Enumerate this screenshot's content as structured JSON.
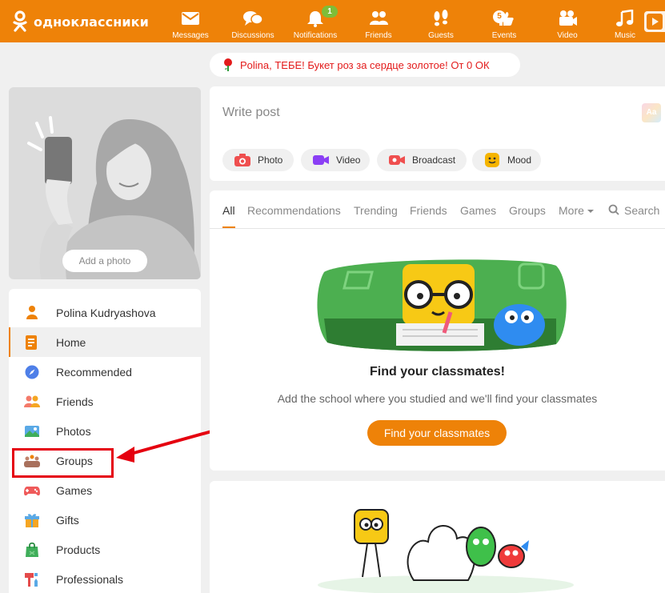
{
  "app": {
    "logo_text": "одноклассники"
  },
  "nav": [
    {
      "id": "messages",
      "label": "Messages",
      "icon": "envelope-icon"
    },
    {
      "id": "discussions",
      "label": "Discussions",
      "icon": "chat-bubbles-icon"
    },
    {
      "id": "notifications",
      "label": "Notifications",
      "icon": "bell-icon",
      "badge": "1"
    },
    {
      "id": "friends",
      "label": "Friends",
      "icon": "people-icon"
    },
    {
      "id": "guests",
      "label": "Guests",
      "icon": "footprints-icon"
    },
    {
      "id": "events",
      "label": "Events",
      "icon": "thumbs-up-icon",
      "badge": "5"
    },
    {
      "id": "video",
      "label": "Video",
      "icon": "video-camera-icon"
    },
    {
      "id": "music",
      "label": "Music",
      "icon": "music-note-icon"
    }
  ],
  "promo": {
    "text": "Polina, ТЕБЕ! Букет роз за сердце золотое! От 0 ОК",
    "icon": "rose-icon"
  },
  "profile": {
    "add_photo_label": "Add a photo"
  },
  "sidebar": {
    "items": [
      {
        "label": "Polina Kudryashova",
        "icon": "person-icon",
        "color": "#ee8208"
      },
      {
        "label": "Home",
        "icon": "feed-icon",
        "color": "#ee8208",
        "active": true
      },
      {
        "label": "Recommended",
        "icon": "compass-icon",
        "color": "#4e7fe8"
      },
      {
        "label": "Friends",
        "icon": "friends-icon",
        "color": "#f47a6a"
      },
      {
        "label": "Photos",
        "icon": "photo-icon",
        "color": "#5aa9e6"
      },
      {
        "label": "Groups",
        "icon": "groups-icon",
        "color": "#c0826b"
      },
      {
        "label": "Games",
        "icon": "gamepad-icon",
        "color": "#ef5a5a"
      },
      {
        "label": "Gifts",
        "icon": "gift-icon",
        "color": "#f5a623"
      },
      {
        "label": "Products",
        "icon": "shopping-bag-icon",
        "color": "#3fae5a"
      },
      {
        "label": "Professionals",
        "icon": "tools-icon",
        "color": "#e44b4b"
      }
    ]
  },
  "composer": {
    "placeholder": "Write post",
    "format_icon_label": "Aa",
    "actions": [
      {
        "label": "Photo",
        "icon": "camera-icon",
        "color": "#ef4f4f"
      },
      {
        "label": "Video",
        "icon": "video-icon",
        "color": "#8b3ff5"
      },
      {
        "label": "Broadcast",
        "icon": "broadcast-icon",
        "color": "#ef4f4f"
      },
      {
        "label": "Mood",
        "icon": "smiley-icon",
        "color": "#f5b400"
      }
    ]
  },
  "feed": {
    "tabs": [
      "All",
      "Recommendations",
      "Trending",
      "Friends",
      "Games",
      "Groups",
      "More",
      "Search"
    ],
    "active_tab": "All",
    "find_title": "Find your classmates!",
    "find_subtitle": "Add the school where you studied and we'll find your classmates",
    "find_button": "Find your classmates"
  },
  "colors": {
    "brand": "#ee8208",
    "annotation": "#e5000f",
    "badge": "#7ebd38"
  }
}
